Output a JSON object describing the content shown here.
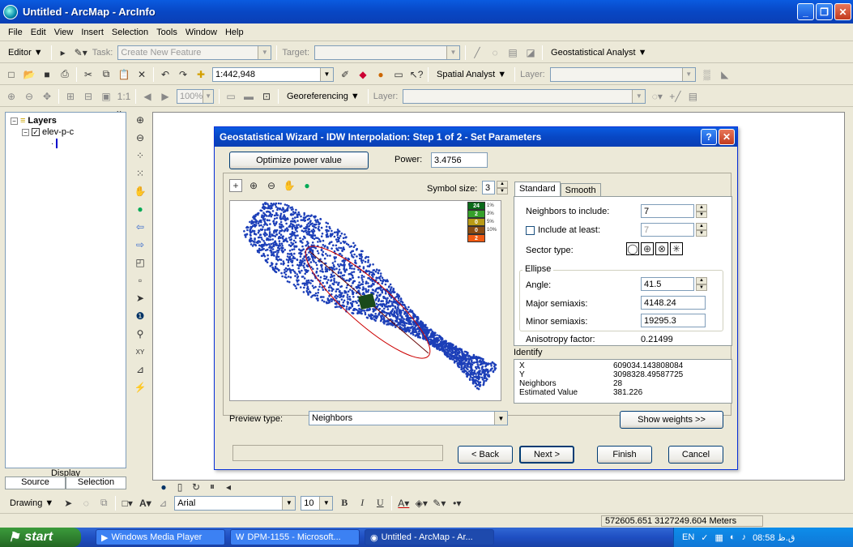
{
  "window": {
    "title": "Untitled - ArcMap - ArcInfo"
  },
  "menu": [
    "File",
    "Edit",
    "View",
    "Insert",
    "Selection",
    "Tools",
    "Window",
    "Help"
  ],
  "editor_toolbar": {
    "editor_label": "Editor ▼",
    "task_label": "Task:",
    "task_value": "Create New Feature",
    "target_label": "Target:",
    "target_value": "",
    "geostat_label": "Geostatistical Analyst ▼"
  },
  "standard_toolbar": {
    "scale_value": "1:442,948",
    "spatial_label": "Spatial Analyst ▼",
    "layer_label": "Layer:",
    "layer_value": ""
  },
  "georef_toolbar": {
    "zoom_value": "100%",
    "georef_label": "Georeferencing ▼",
    "layer_label": "Layer:",
    "layer_value": ""
  },
  "toc": {
    "layers_label": "Layers",
    "layer_name": "elev-p-c",
    "display_tab": "Display",
    "source_tab": "Source",
    "selection_tab": "Selection"
  },
  "dialog": {
    "title": "Geostatistical Wizard - IDW Interpolation: Step 1 of 2 - Set Parameters",
    "optimize_button": "Optimize power value",
    "power_label": "Power:",
    "power_value": "3.4756",
    "symbol_size_label": "Symbol size:",
    "symbol_size_value": "3",
    "tab_standard": "Standard",
    "tab_smooth": "Smooth",
    "neighbors_label": "Neighbors to include:",
    "neighbors_value": "7",
    "include_least_label": "Include at least:",
    "include_least_value": "7",
    "sector_label": "Sector type:",
    "ellipse_label": "Ellipse",
    "angle_label": "Angle:",
    "angle_value": "41.5",
    "major_label": "Major semiaxis:",
    "major_value": "4148.24",
    "minor_label": "Minor semiaxis:",
    "minor_value": "19295.3",
    "aniso_label": "Anisotropy factor:",
    "aniso_value": "0.21499",
    "identify_label": "Identify",
    "id_x_label": "X",
    "id_x_value": "609034.143808084",
    "id_y_label": "Y",
    "id_y_value": "3098328.49587725",
    "id_n_label": "Neighbors",
    "id_n_value": "28",
    "id_est_label": "Estimated Value",
    "id_est_value": "381.226",
    "preview_type_label": "Preview type:",
    "preview_type_value": "Neighbors",
    "show_weights": "Show weights >>",
    "back": "< Back",
    "next": "Next >",
    "finish": "Finish",
    "cancel": "Cancel",
    "legend": [
      {
        "value": "24",
        "label": "1%",
        "color": "#0b6b1a"
      },
      {
        "value": "2",
        "label": "3%",
        "color": "#35a02a"
      },
      {
        "value": "0",
        "label": "5%",
        "color": "#b89a16"
      },
      {
        "value": "0",
        "label": "10%",
        "color": "#8a4a12"
      },
      {
        "value": "2",
        "label": "",
        "color": "#f05a12"
      }
    ]
  },
  "drawing_toolbar": {
    "drawing_label": "Drawing ▼",
    "font_value": "Arial",
    "size_value": "10"
  },
  "status": {
    "coords": "572605.651  3127249.604 Meters"
  },
  "taskbar": {
    "start": "start",
    "tasks": [
      "Windows Media Player",
      "DPM-1155 - Microsoft...",
      "Untitled - ArcMap - Ar..."
    ],
    "lang": "EN",
    "clock": "08:58 ق.ظ"
  }
}
